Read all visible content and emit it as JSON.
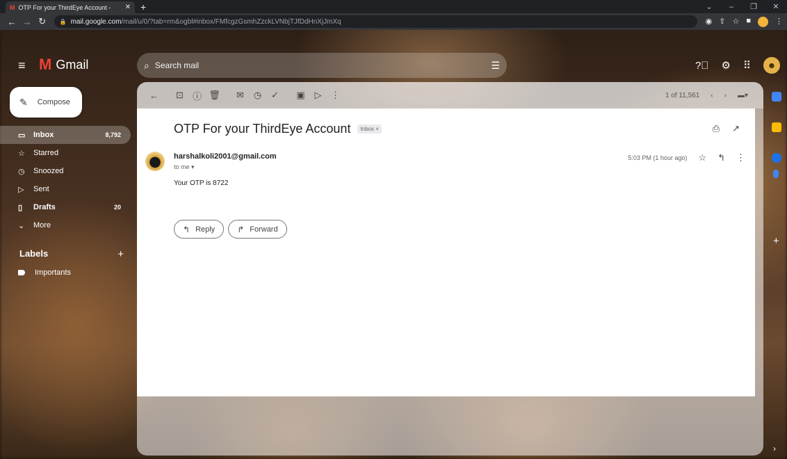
{
  "browser": {
    "tab_title": "OTP For your ThirdEye Account -",
    "tab_favicon": "M",
    "url_host": "mail.google.com",
    "url_path": "/mail/u/0/?tab=rm&ogbl#inbox/FMfcgzGsmhZzckLVNbjTJfDdHnXjJmXq"
  },
  "header": {
    "logo_text": "Gmail",
    "search_placeholder": "Search mail"
  },
  "sidebar": {
    "compose_label": "Compose",
    "items": [
      {
        "label": "Inbox",
        "count": "8,792",
        "icon": "inbox-icon"
      },
      {
        "label": "Starred",
        "count": "",
        "icon": "star-icon"
      },
      {
        "label": "Snoozed",
        "count": "",
        "icon": "clock-icon"
      },
      {
        "label": "Sent",
        "count": "",
        "icon": "send-icon"
      },
      {
        "label": "Drafts",
        "count": "20",
        "icon": "draft-icon"
      },
      {
        "label": "More",
        "count": "",
        "icon": "chevron-down-icon"
      }
    ],
    "labels_title": "Labels",
    "labels": [
      {
        "label": "Importants"
      }
    ]
  },
  "toolbar": {
    "pagination": "1 of 11,561"
  },
  "message": {
    "subject": "OTP For your ThirdEye Account",
    "label_chip": "Inbox ×",
    "sender": "harshalkoli2001@gmail.com",
    "to": "to me ▾",
    "time": "5:03 PM (1 hour ago)",
    "body": "Your OTP is 8722",
    "reply_label": "Reply",
    "forward_label": "Forward"
  },
  "colors": {
    "gmail_red": "#ea4335",
    "chrome_dark": "#202124"
  }
}
